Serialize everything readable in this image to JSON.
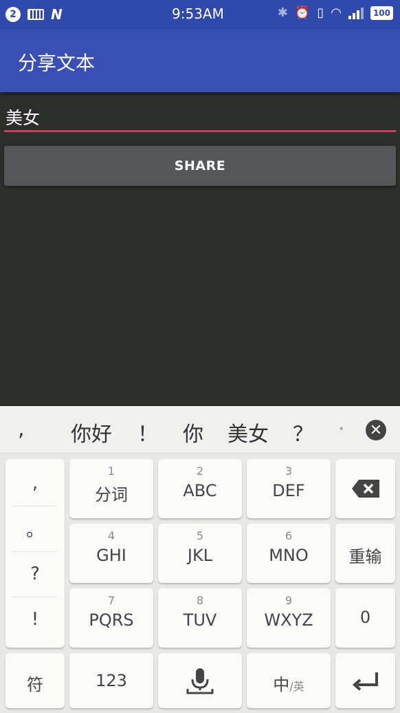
{
  "status": {
    "badge": "2",
    "n_icon": "N",
    "time": "9:53AM",
    "battery": "100"
  },
  "app": {
    "title": "分享文本"
  },
  "input": {
    "value": "美女"
  },
  "share_label": "SHARE",
  "candidates": [
    ",",
    "你好",
    "！",
    "你",
    "美女",
    "？",
    "·"
  ],
  "keyboard": {
    "punct": [
      ",",
      "。",
      "?",
      "!"
    ],
    "keys": [
      {
        "num": "1",
        "label": "分词"
      },
      {
        "num": "2",
        "label": "ABC"
      },
      {
        "num": "3",
        "label": "DEF"
      },
      {
        "num": "4",
        "label": "GHI"
      },
      {
        "num": "5",
        "label": "JKL"
      },
      {
        "num": "6",
        "label": "MNO"
      },
      {
        "num": "7",
        "label": "PQRS"
      },
      {
        "num": "8",
        "label": "TUV"
      },
      {
        "num": "9",
        "label": "WXYZ"
      }
    ],
    "reinput": "重输",
    "zero": "0",
    "symbol": "符",
    "num123": "123",
    "zh": "中",
    "en": "/英"
  }
}
